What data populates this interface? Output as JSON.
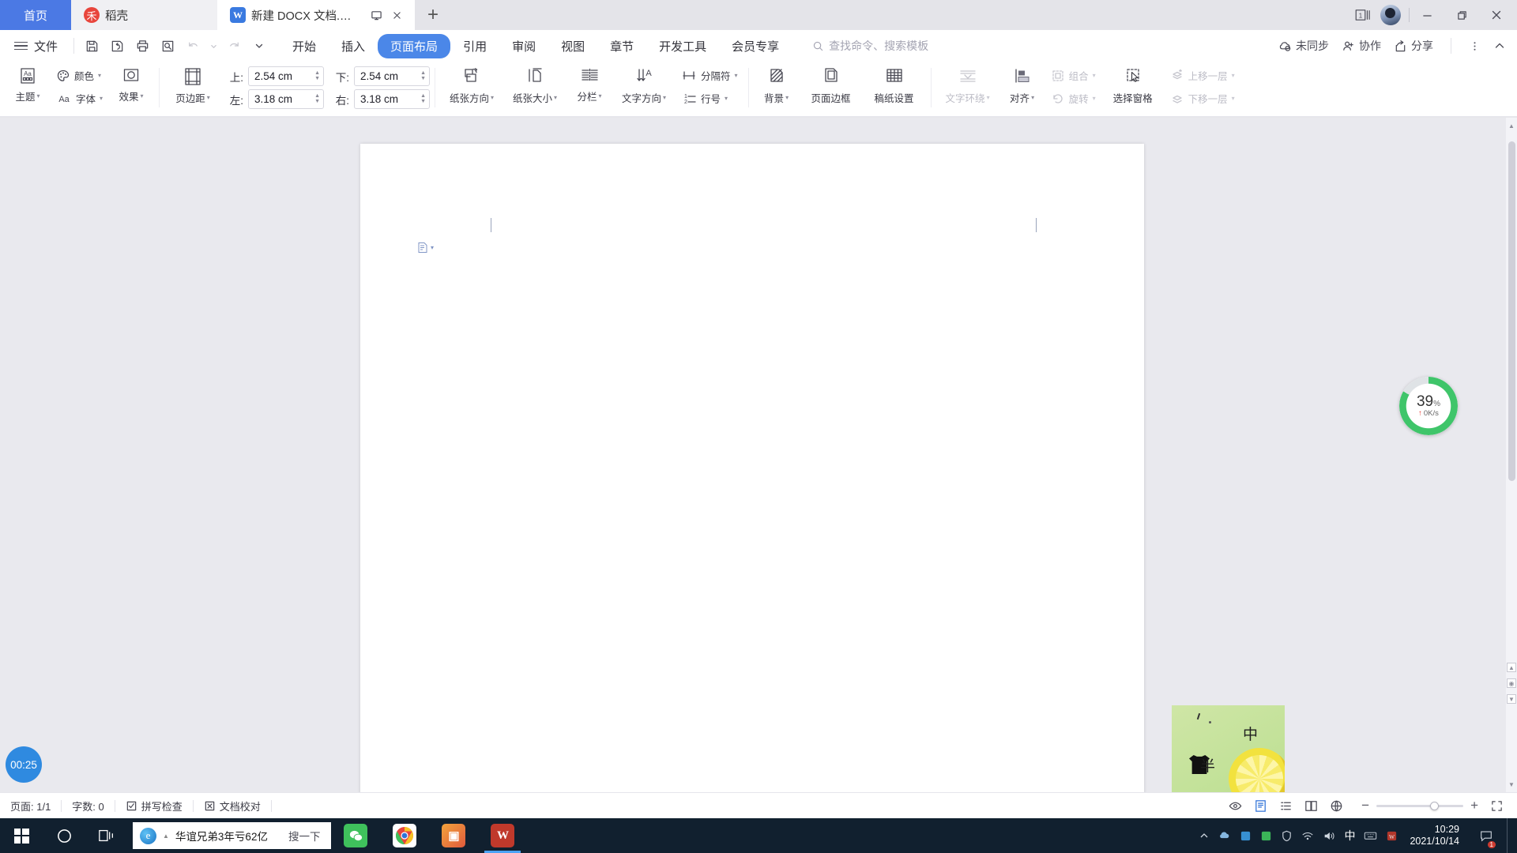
{
  "tabbar": {
    "tabs": [
      {
        "label": "首页",
        "icon": "home-icon"
      },
      {
        "label": "稻壳",
        "icon": "daoke-icon"
      },
      {
        "label": "新建 DOCX 文档.docx",
        "icon": "wps-writer-icon"
      }
    ],
    "tab_actions": {
      "present": "monitor-icon",
      "close": "close-icon"
    },
    "new_tab": "+",
    "window_badge": "1",
    "window_controls": {
      "minimize": "—",
      "maximize": "❐",
      "close": "✕"
    }
  },
  "menubar": {
    "file_label": "文件",
    "quick_access": [
      "save-icon",
      "save-as-icon",
      "print-icon",
      "print-preview-icon",
      "undo-icon",
      "redo-icon",
      "customize-icon"
    ],
    "tabs": [
      {
        "label": "开始",
        "active": false
      },
      {
        "label": "插入",
        "active": false
      },
      {
        "label": "页面布局",
        "active": true
      },
      {
        "label": "引用",
        "active": false
      },
      {
        "label": "审阅",
        "active": false
      },
      {
        "label": "视图",
        "active": false
      },
      {
        "label": "章节",
        "active": false
      },
      {
        "label": "开发工具",
        "active": false
      },
      {
        "label": "会员专享",
        "active": false
      }
    ],
    "search_placeholder": "查找命令、搜索模板",
    "right_items": [
      {
        "label": "未同步",
        "icon": "cloud-unsynced-icon"
      },
      {
        "label": "协作",
        "icon": "collaborate-icon"
      },
      {
        "label": "分享",
        "icon": "share-icon"
      }
    ],
    "more_icon": "more-vertical-icon",
    "collapse_icon": "chevron-up-icon"
  },
  "ribbon": {
    "theme_group": [
      {
        "label": "主题",
        "icon": "theme-icon",
        "caret": true
      },
      {
        "label": "字体",
        "icon": "theme-font-icon",
        "caret": true
      },
      {
        "label": "效果",
        "icon": "theme-effect-icon",
        "caret": true
      },
      {
        "label": "颜色",
        "icon": "theme-color-icon",
        "caret": true
      }
    ],
    "margins": {
      "button_label": "页边距",
      "button_icon": "page-margins-icon",
      "fields": [
        {
          "label": "上:",
          "value": "2.54 cm"
        },
        {
          "label": "下:",
          "value": "2.54 cm"
        },
        {
          "label": "左:",
          "value": "3.18 cm"
        },
        {
          "label": "右:",
          "value": "3.18 cm"
        }
      ]
    },
    "page_group": [
      {
        "label": "纸张方向",
        "icon": "paper-orientation-icon",
        "caret": true
      },
      {
        "label": "纸张大小",
        "icon": "paper-size-icon",
        "caret": true
      },
      {
        "label": "分栏",
        "icon": "columns-icon",
        "caret": true
      },
      {
        "label": "文字方向",
        "icon": "text-direction-icon",
        "caret": true
      }
    ],
    "break_group": [
      {
        "label": "分隔符",
        "icon": "separator-icon",
        "caret": true
      },
      {
        "label": "行号",
        "icon": "line-number-icon",
        "caret": true
      }
    ],
    "bg_group": [
      {
        "label": "背景",
        "icon": "background-icon",
        "caret": true
      },
      {
        "label": "页面边框",
        "icon": "page-border-icon",
        "caret": false
      },
      {
        "label": "稿纸设置",
        "icon": "manuscript-paper-icon",
        "caret": false
      }
    ],
    "arrange_group": [
      {
        "label": "文字环绕",
        "icon": "text-wrap-icon",
        "caret": true,
        "disabled": true
      },
      {
        "label": "对齐",
        "icon": "align-objects-icon",
        "caret": true,
        "disabled": false
      }
    ],
    "group_stack": [
      {
        "label": "组合",
        "icon": "group-objects-icon",
        "caret": true,
        "disabled": true
      },
      {
        "label": "旋转",
        "icon": "rotate-icon",
        "caret": true,
        "disabled": true
      }
    ],
    "select_pane": {
      "label": "选择窗格",
      "icon": "selection-pane-icon"
    },
    "layer_stack": [
      {
        "label": "上移一层",
        "icon": "bring-forward-icon",
        "caret": true,
        "disabled": true
      },
      {
        "label": "下移一层",
        "icon": "send-backward-icon",
        "caret": true,
        "disabled": true
      }
    ]
  },
  "document": {
    "object_anchor_icon": "object-anchor-icon",
    "page_number": "1"
  },
  "widgets": {
    "net_speed": {
      "percent": "39",
      "percent_unit": "%",
      "rate": "0K/s",
      "arrow": "upload-arrow-icon"
    },
    "timer": {
      "value": "00:25"
    },
    "ad_card": {
      "char_top": "中",
      "char_bottom": "半"
    }
  },
  "statusbar": {
    "left_items": [
      {
        "label": "页面: 1/1",
        "icon": null
      },
      {
        "label": "字数: 0",
        "icon": null
      },
      {
        "label": "拼写检查",
        "icon": "spellcheck-icon"
      },
      {
        "label": "文档校对",
        "icon": "proofread-icon"
      }
    ],
    "view_buttons": [
      {
        "icon": "eye-icon",
        "active": false
      },
      {
        "icon": "page-view-icon",
        "active": true
      },
      {
        "icon": "outline-view-icon",
        "active": false
      },
      {
        "icon": "two-page-view-icon",
        "active": false
      },
      {
        "icon": "web-view-icon",
        "active": false
      }
    ],
    "zoom": {
      "minus": "−",
      "plus": "+",
      "fullscreen_icon": "fullscreen-icon"
    }
  },
  "taskbar": {
    "start_icon": "windows-start-icon",
    "search_icon": "cortana-circle-icon",
    "taskview_icon": "task-view-icon",
    "ie_item": {
      "label": "华谊兄弟3年亏62亿",
      "icon": "internet-explorer-icon"
    },
    "search_box": "搜一下",
    "apps": [
      {
        "icon": "wechat-icon",
        "color": "#3fc15c",
        "glyph": "💬"
      },
      {
        "icon": "chrome-icon",
        "color": "#ffffff",
        "glyph": "◉"
      },
      {
        "icon": "photos-icon",
        "color": "#ed6c3a",
        "glyph": "▣"
      },
      {
        "icon": "wps-icon",
        "color": "#c0392b",
        "glyph": "W",
        "active": true
      }
    ],
    "tray_icons": [
      "chevron-up-icon",
      "cloud-icon",
      "app-icon",
      "shield-icon",
      "wifi-icon",
      "volume-icon",
      "keyboard-icon"
    ],
    "ime_label": "中",
    "clock": {
      "time": "10:29",
      "date": "2021/10/14"
    },
    "notification_count": "1"
  }
}
